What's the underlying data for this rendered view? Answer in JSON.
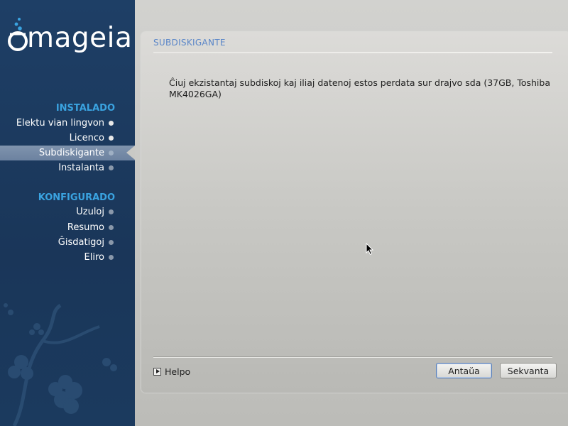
{
  "brand": {
    "logo_text": "mageia"
  },
  "sidebar": {
    "sections": [
      {
        "title": "INSTALADO",
        "steps": [
          {
            "label": "Elektu vian lingvon"
          },
          {
            "label": "Licenco"
          },
          {
            "label": "Subdiskigante"
          },
          {
            "label": "Instalanta"
          }
        ]
      },
      {
        "title": "KONFIGURADO",
        "steps": [
          {
            "label": "Uzuloj"
          },
          {
            "label": "Resumo"
          },
          {
            "label": "Ĝisdatigoj"
          },
          {
            "label": "Eliro"
          }
        ]
      }
    ],
    "active_step": "Subdiskigante"
  },
  "main": {
    "title": "SUBDISKIGANTE",
    "message": "Ĉiuj ekzistantaj subdiskoj kaj iliaj datenoj estos perdata sur drajvo sda (37GB, Toshiba MK4026GA)",
    "help_label": "Helpo",
    "prev_label": "Antaŭa",
    "next_label": "Sekvanta"
  },
  "colors": {
    "sidebar_bg": "#1e3f66",
    "section_title": "#3aa3e0",
    "panel_title": "#5a86c8"
  }
}
